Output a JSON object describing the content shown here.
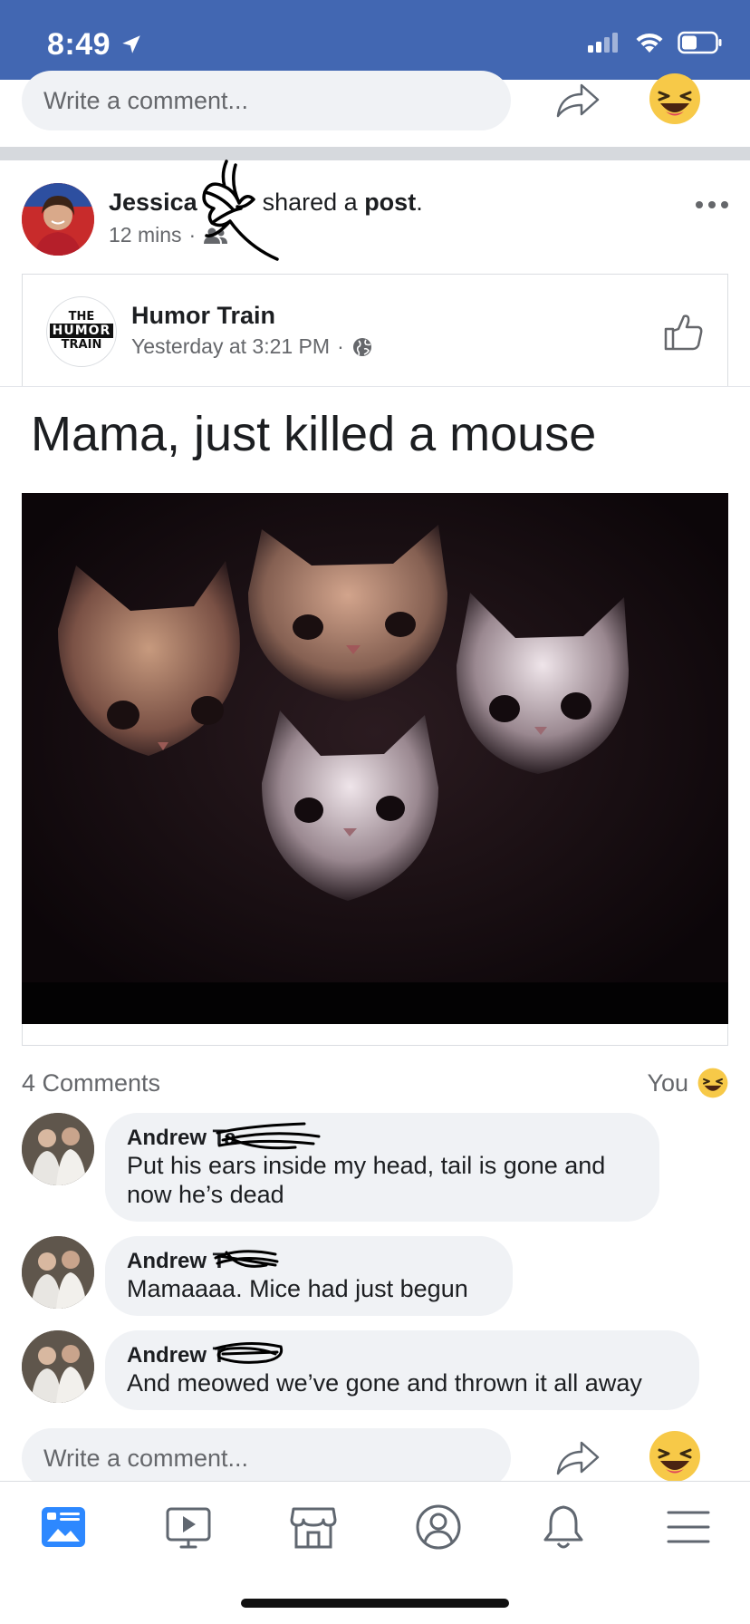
{
  "status_bar": {
    "time": "8:49"
  },
  "comment_composer": {
    "placeholder": "Write a comment..."
  },
  "post": {
    "author_first": "Jessica",
    "shared_text": "shared a ",
    "shared_object": "post",
    "period": ".",
    "time": "12 mins",
    "audience_icon": "friends-icon"
  },
  "shared_card": {
    "page_name": "Humor Train",
    "logo_lines": [
      "THE",
      "HUMOR",
      "TRAIN"
    ],
    "time": "Yesterday at 3:21 PM",
    "audience_icon": "globe-icon"
  },
  "post_text": "Mama, just killed a mouse",
  "comments_summary": {
    "count_label": "4 Comments",
    "reaction_label": "You"
  },
  "comments": [
    {
      "name": "Andrew Ta",
      "text_lines": [
        "Put his ears inside my head, tail is gone and",
        "now he’s dead"
      ]
    },
    {
      "name": "Andrew T",
      "text_lines": [
        "Mamaaaa. Mice had just begun"
      ]
    },
    {
      "name": "Andrew T",
      "text_lines": [
        "And meowed we’ve gone and thrown it all away"
      ]
    }
  ],
  "bottom_nav": [
    "news-feed",
    "watch",
    "marketplace",
    "profile",
    "notifications",
    "menu"
  ],
  "colors": {
    "brand": "#4267b2",
    "bubble": "#f0f2f5",
    "haha": "#f7c948"
  }
}
